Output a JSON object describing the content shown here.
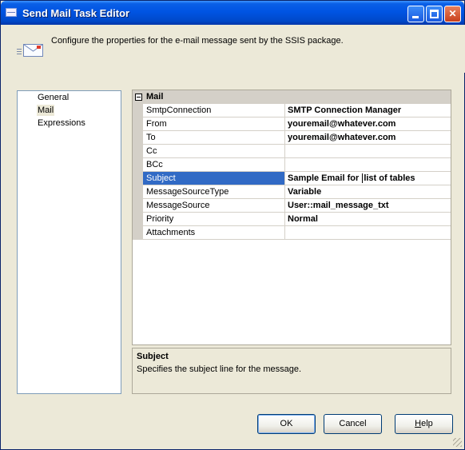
{
  "window": {
    "title": "Send Mail Task Editor"
  },
  "header": {
    "description": "Configure the properties for the e-mail message sent by the SSIS package."
  },
  "nav": {
    "items": [
      "General",
      "Mail",
      "Expressions"
    ],
    "selected": "Mail"
  },
  "grid": {
    "category": "Mail",
    "properties": [
      {
        "name": "SmtpConnection",
        "value": "SMTP Connection Manager"
      },
      {
        "name": "From",
        "value": "youremail@whatever.com"
      },
      {
        "name": "To",
        "value": "youremail@whatever.com"
      },
      {
        "name": "Cc",
        "value": ""
      },
      {
        "name": "BCc",
        "value": ""
      },
      {
        "name": "Subject",
        "value_before_caret": "Sample Email for ",
        "value_after_caret": "list of tables"
      },
      {
        "name": "MessageSourceType",
        "value": "Variable"
      },
      {
        "name": "MessageSource",
        "value": "User::mail_message_txt"
      },
      {
        "name": "Priority",
        "value": "Normal"
      },
      {
        "name": "Attachments",
        "value": ""
      }
    ],
    "selected_property": "Subject"
  },
  "description_panel": {
    "title": "Subject",
    "text": "Specifies the subject line for the message."
  },
  "buttons": {
    "ok": "OK",
    "cancel": "Cancel",
    "help": "Help"
  },
  "colors": {
    "titlebar": "#0054e3",
    "selection": "#316ac5",
    "dialog_bg": "#ece9d8"
  }
}
